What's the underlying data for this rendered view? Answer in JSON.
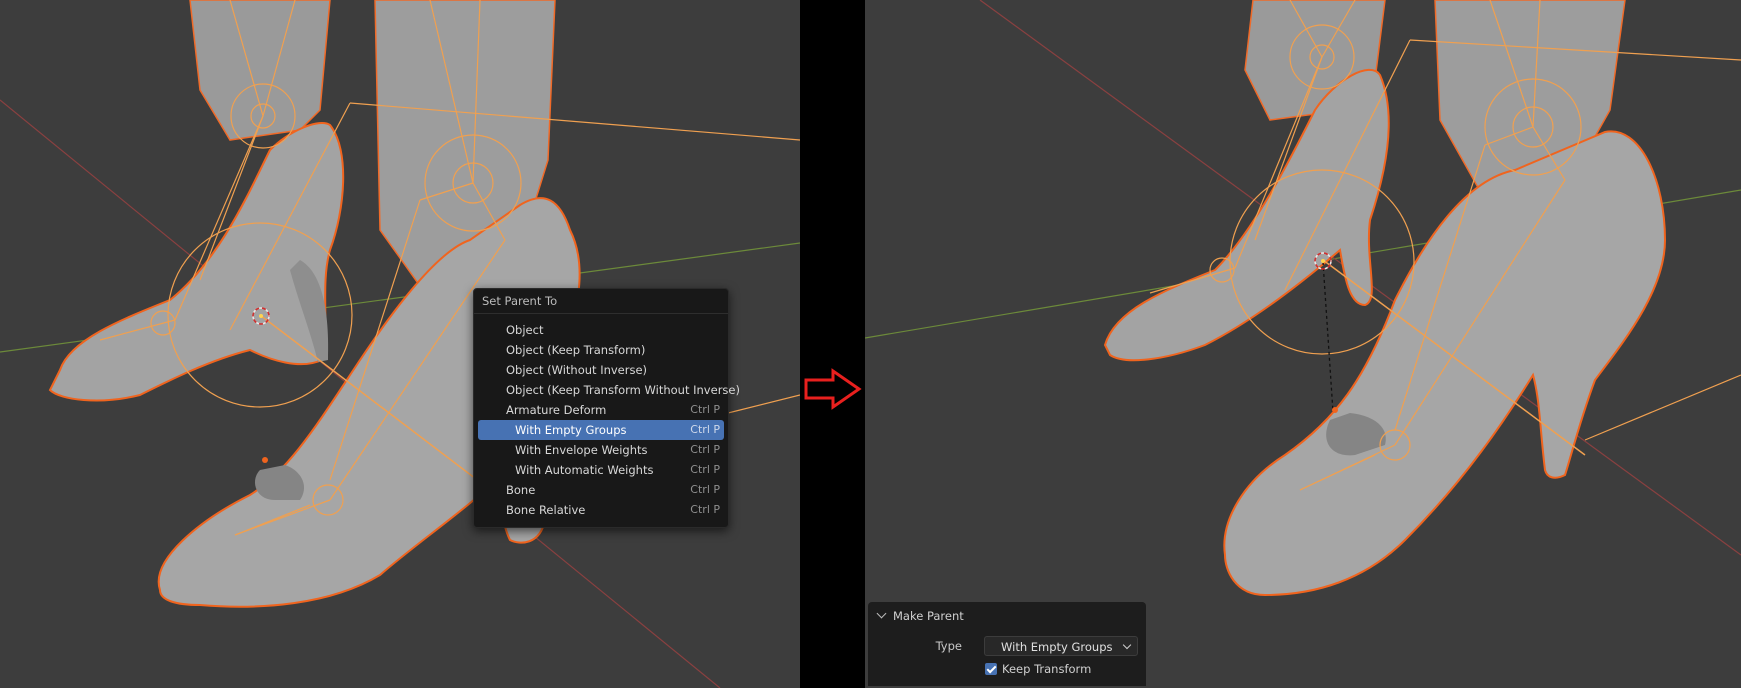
{
  "context_menu": {
    "title": "Set Parent To",
    "items": [
      {
        "label": "Object",
        "shortcut": ""
      },
      {
        "label": "Object (Keep Transform)",
        "shortcut": ""
      },
      {
        "label": "Object (Without Inverse)",
        "shortcut": ""
      },
      {
        "label": "Object (Keep Transform Without Inverse)",
        "shortcut": ""
      },
      {
        "label": "Armature Deform",
        "shortcut": "Ctrl P"
      },
      {
        "label": "With Empty Groups",
        "shortcut": "Ctrl P",
        "active": true
      },
      {
        "label": "With Envelope Weights",
        "shortcut": "Ctrl P"
      },
      {
        "label": "With Automatic Weights",
        "shortcut": "Ctrl P"
      },
      {
        "label": "Bone",
        "shortcut": "Ctrl P"
      },
      {
        "label": "Bone Relative",
        "shortcut": "Ctrl P"
      }
    ]
  },
  "operator_panel": {
    "title": "Make Parent",
    "type_label": "Type",
    "type_value": "With Empty Groups",
    "keep_transform_label": "Keep Transform",
    "keep_transform_checked": true
  },
  "colors": {
    "viewport_bg": "#3d3d3d",
    "selection_outline": "#f0641e",
    "armature": "#f0a050",
    "menu_highlight": "#4772b3",
    "arrow": "#e8201e"
  },
  "icons": [
    "arrow-right-icon",
    "chevron-down-icon",
    "checkbox-checked-icon",
    "3d-cursor-icon"
  ]
}
